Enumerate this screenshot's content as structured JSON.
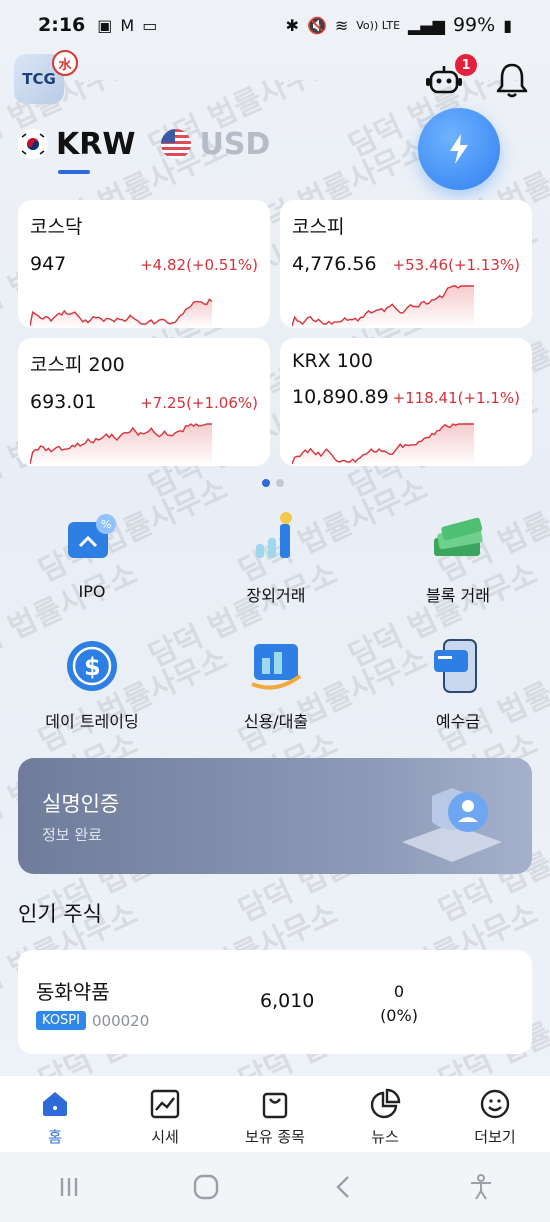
{
  "status_bar": {
    "time": "2:16",
    "battery": "99%",
    "network": "Vo)) LTE"
  },
  "header": {
    "logo_text": "TCG",
    "logo_badge": "水",
    "notification_count": "1"
  },
  "currency_tabs": [
    {
      "label": "KRW",
      "active": true
    },
    {
      "label": "USD",
      "active": false
    }
  ],
  "indices": [
    {
      "name": "코스닥",
      "price": "947",
      "change": "+4.82(+0.51%)"
    },
    {
      "name": "코스피",
      "price": "4,776.56",
      "change": "+53.46(+1.13%)"
    },
    {
      "name": "코스피 200",
      "price": "693.01",
      "change": "+7.25(+1.06%)"
    },
    {
      "name": "KRX 100",
      "price": "10,890.89",
      "change": "+118.41(+1.1%)"
    }
  ],
  "menu": [
    {
      "label": "IPO",
      "icon": "ipo-icon"
    },
    {
      "label": "장외거래",
      "icon": "otc-chart-icon"
    },
    {
      "label": "블록 거래",
      "icon": "money-stack-icon"
    },
    {
      "label": "데이 트레이딩",
      "icon": "dollar-coin-icon"
    },
    {
      "label": "신용/대출",
      "icon": "credit-loan-icon"
    },
    {
      "label": "예수금",
      "icon": "deposit-card-icon"
    }
  ],
  "verification": {
    "title": "실명인증",
    "subtitle": "정보 완료"
  },
  "popular": {
    "title": "인기 주식",
    "stocks": [
      {
        "name": "동화약품",
        "market": "KOSPI",
        "code": "000020",
        "price": "6,010",
        "change": "0",
        "change_pct": "(0%)"
      }
    ]
  },
  "bottom_nav": [
    {
      "label": "홈",
      "active": true
    },
    {
      "label": "시세",
      "active": false
    },
    {
      "label": "보유 종목",
      "active": false
    },
    {
      "label": "뉴스",
      "active": false
    },
    {
      "label": "더보기",
      "active": false
    }
  ],
  "colors": {
    "accent": "#2f6bd8",
    "up": "#d8313a",
    "market_badge": "#2f87ea",
    "notification": "#e5203a"
  },
  "watermark": "담덕 법률사무소"
}
